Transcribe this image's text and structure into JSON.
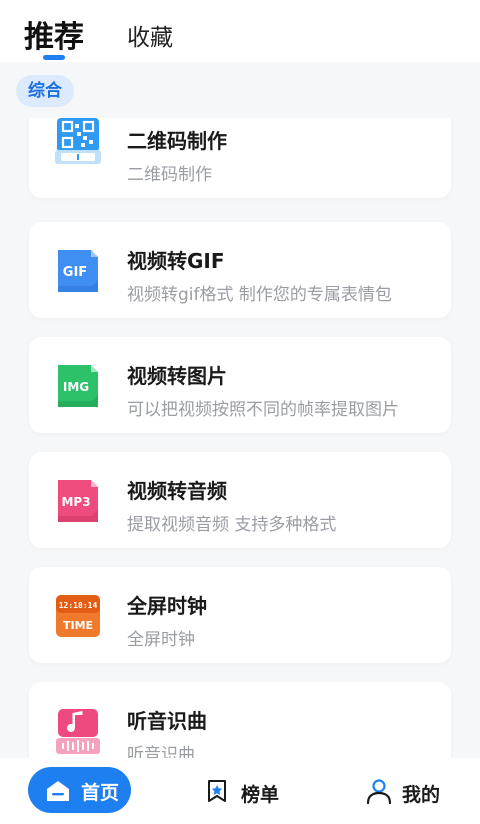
{
  "header": {
    "tabs": [
      {
        "label": "推荐",
        "active": true
      },
      {
        "label": "收藏",
        "active": false
      }
    ],
    "accent_color": "#1e80f0"
  },
  "filter": {
    "label": "综合"
  },
  "tools": [
    {
      "title": "二维码制作",
      "subtitle": "二维码制作",
      "icon": "qr-code-icon",
      "color": "#2f9af2"
    },
    {
      "title": "视频转GIF",
      "subtitle": "视频转gif格式 制作您的专属表情包",
      "icon": "gif-file-icon",
      "icon_text": "GIF",
      "color": "#3f8ff3"
    },
    {
      "title": "视频转图片",
      "subtitle": "可以把视频按照不同的帧率提取图片",
      "icon": "img-file-icon",
      "icon_text": "IMG",
      "color": "#2cc26a"
    },
    {
      "title": "视频转音频",
      "subtitle": "提取视频音频 支持多种格式",
      "icon": "mp3-file-icon",
      "icon_text": "MP3",
      "color": "#ee4c7d"
    },
    {
      "title": "全屏时钟",
      "subtitle": "全屏时钟",
      "icon": "clock-time-icon",
      "icon_text": "TIME",
      "clock_text": "12:18:14",
      "color": "#f07a2c"
    },
    {
      "title": "听音识曲",
      "subtitle": "听音识曲",
      "icon": "music-note-icon",
      "color": "#ef4a7f"
    }
  ],
  "bottom_nav": {
    "home": {
      "label": "首页",
      "icon": "home-icon"
    },
    "rank": {
      "label": "榜单",
      "icon": "bookmark-star-icon"
    },
    "mine": {
      "label": "我的",
      "icon": "user-icon"
    }
  }
}
